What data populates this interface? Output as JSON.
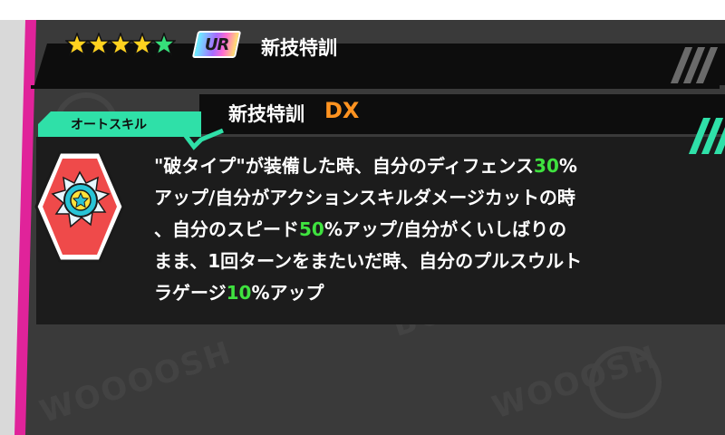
{
  "card": {
    "star_count": 5,
    "star_colors": [
      "#ffd21f",
      "#ffd21f",
      "#ffd21f",
      "#ffd21f",
      "#36e07a"
    ],
    "rarity": "UR",
    "title": "新技特訓"
  },
  "skill": {
    "type_tag": "オートスキル",
    "name": "新技特訓",
    "name_suffix": "DX",
    "icon": "burst-star-icon",
    "description_lines": [
      [
        {
          "t": "\"破タイプ\"が装備した時、自分のディフェンス"
        },
        {
          "t": "30",
          "hl": true
        },
        {
          "t": "%"
        }
      ],
      [
        {
          "t": "アップ/自分がアクションスキルダメージカットの時"
        }
      ],
      [
        {
          "t": "、自分のスピード"
        },
        {
          "t": "50",
          "hl": true
        },
        {
          "t": "%アップ/自分がくいしばりの"
        }
      ],
      [
        {
          "t": "まま、1回ターンをまたいだ時、自分のプルスウルト"
        }
      ],
      [
        {
          "t": "ラゲージ"
        },
        {
          "t": "10",
          "hl": true
        },
        {
          "t": "%アップ"
        }
      ]
    ]
  },
  "colors": {
    "accent_pink": "#e0239a",
    "accent_green": "#2fe0a8",
    "highlight_green": "#3fe23f",
    "suffix_orange": "#ff9320"
  }
}
